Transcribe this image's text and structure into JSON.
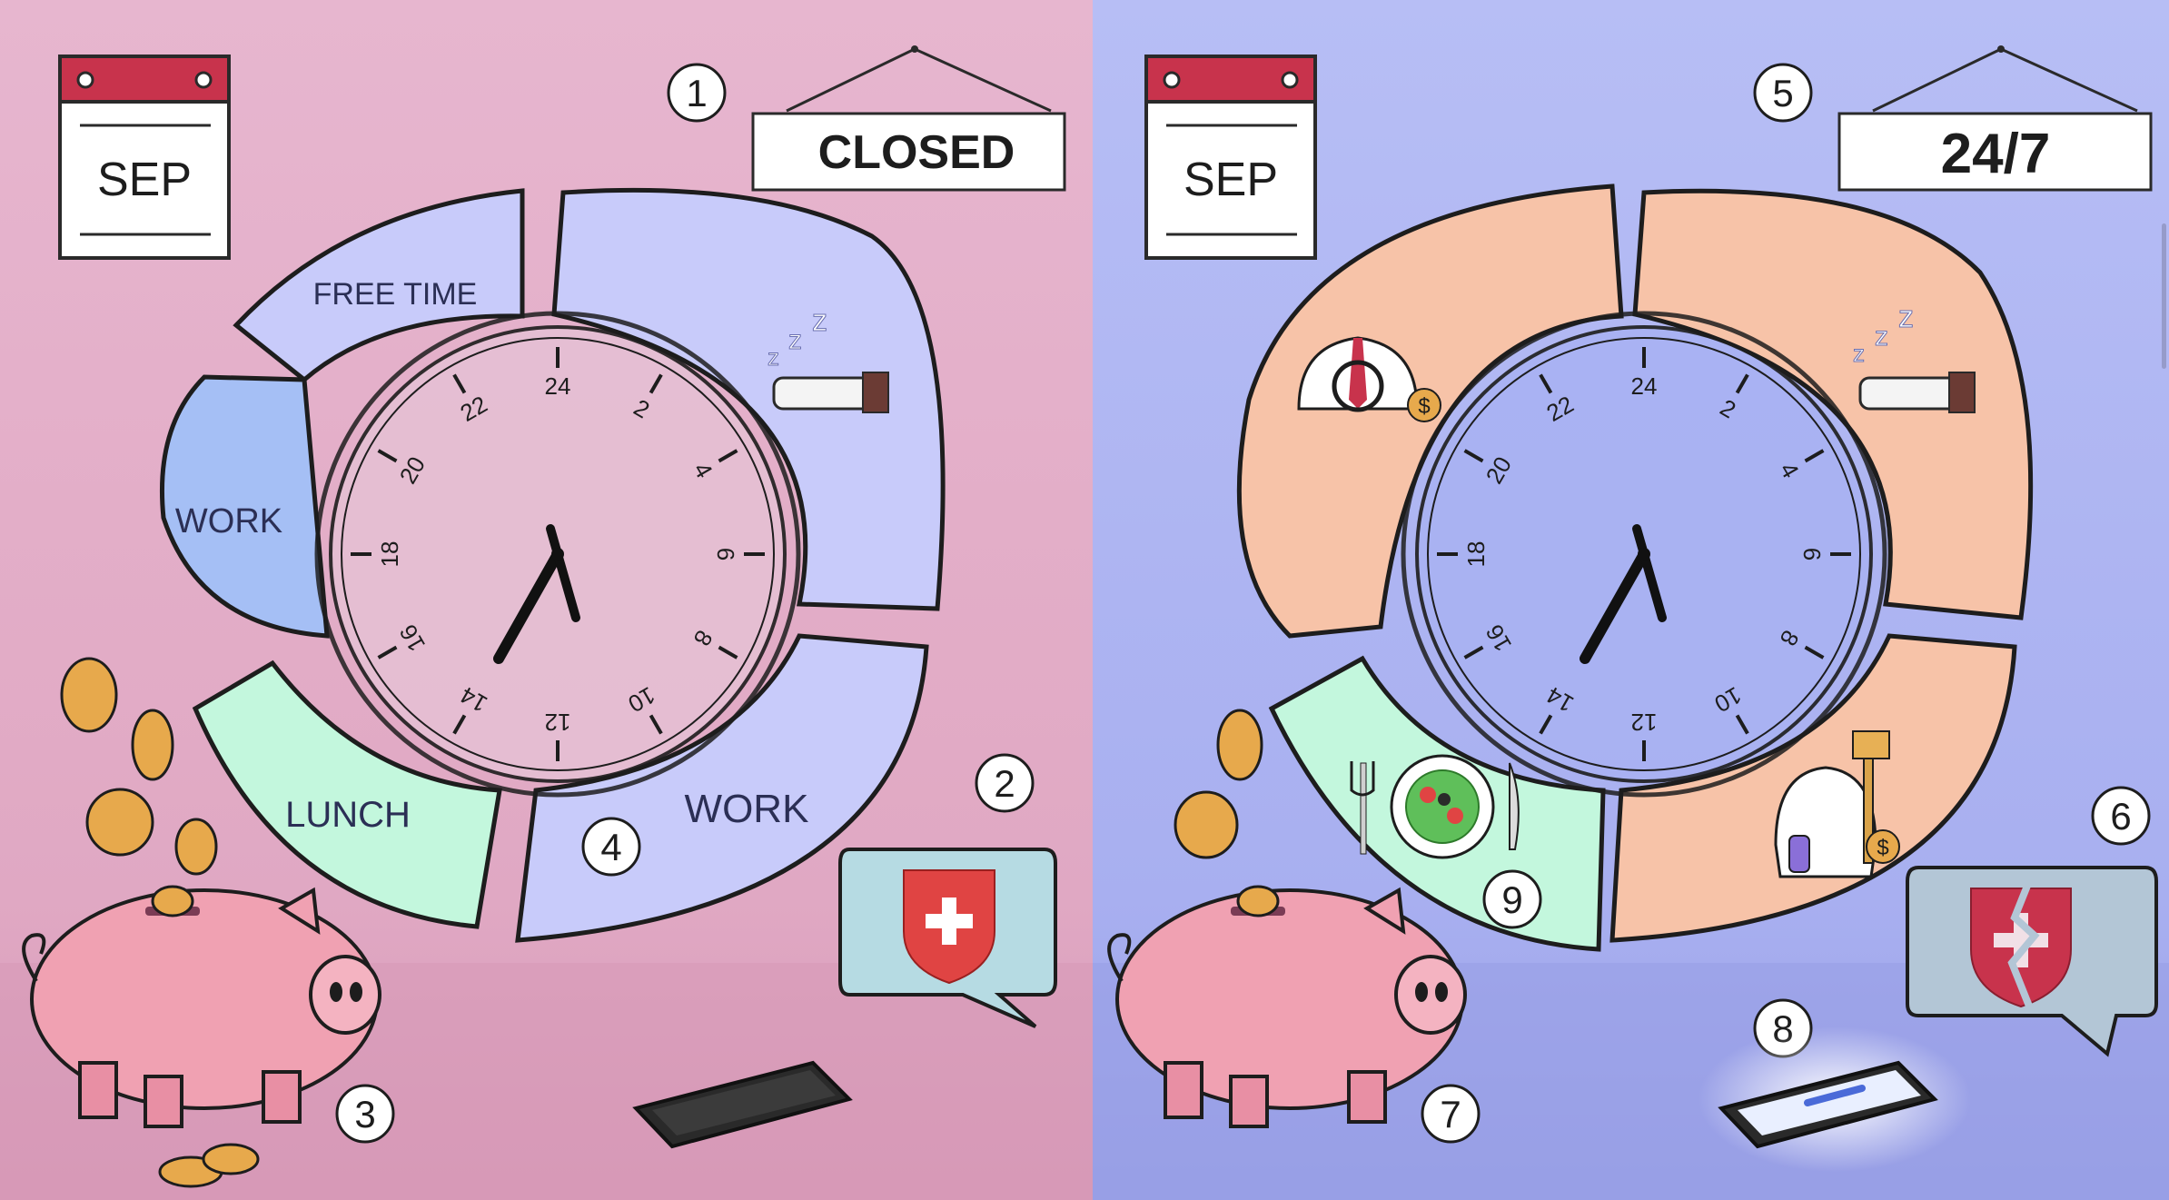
{
  "colors": {
    "left_bg": "#e4b3cc",
    "right_bg": "#b2b8f2",
    "free_time": "#c8cbfa",
    "work_blue": "#a5bff5",
    "lunch": "#c3f7dd",
    "orange": "#f7c3a8",
    "calendar_red": "#c8334c",
    "shield_red": "#e04443",
    "bubble": "#b6dbe3"
  },
  "left": {
    "calendar_month": "SEP",
    "sign_text": "CLOSED",
    "segments": {
      "free_time": "FREE TIME",
      "work_left": "WORK",
      "lunch": "LUNCH",
      "work_right": "WORK"
    },
    "markers": [
      "1",
      "2",
      "3",
      "4"
    ]
  },
  "right": {
    "calendar_month": "SEP",
    "sign_text": "24/7",
    "markers": [
      "5",
      "6",
      "7",
      "8",
      "9"
    ]
  },
  "clock": {
    "hour_labels": [
      "24",
      "2",
      "4",
      "6",
      "8",
      "10",
      "12",
      "14",
      "16",
      "18",
      "20",
      "22"
    ]
  },
  "icons": {
    "sleep": "sleeping-bed-icon",
    "driver": "driver-job-icon",
    "cleaner": "cleaning-job-icon",
    "meal": "meal-plate-icon",
    "shield": "swiss-shield-icon",
    "broken_shield": "broken-shield-icon",
    "piggy": "piggy-bank-icon",
    "phone": "phone-icon",
    "coin": "coin-icon"
  }
}
